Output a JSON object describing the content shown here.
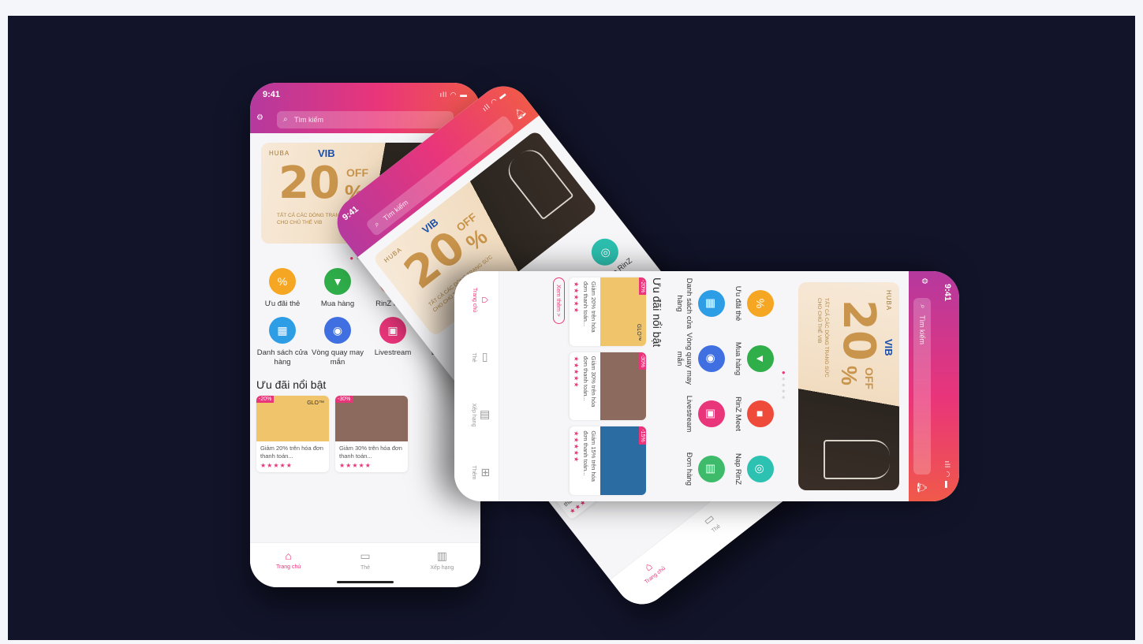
{
  "status": {
    "time": "9:41",
    "icons": "ıll ◠ ▬"
  },
  "search": {
    "placeholder": "Tìm kiếm"
  },
  "banner": {
    "brand": "HUBA",
    "partner": "VIB",
    "discount_number": "20",
    "discount_off": "OFF",
    "discount_pct": "%",
    "subtitle_line1": "TẤT CẢ CÁC DÒNG TRANG SỨC",
    "subtitle_line2": "CHO CHỦ THẺ VIB"
  },
  "pager": {
    "active": "●",
    "rest": "●●●●"
  },
  "grid_items": [
    {
      "label": "Ưu đãi thẻ",
      "icon": "percent-icon",
      "color": "#f5a623",
      "glyph": "%"
    },
    {
      "label": "Mua hàng",
      "icon": "cart-icon",
      "color": "#2fae4a",
      "glyph": "▼"
    },
    {
      "label": "RinZ Meet",
      "icon": "video-icon",
      "color": "#ee4b3a",
      "glyph": "■"
    },
    {
      "label": "Danh sách cửa hàng",
      "icon": "store-icon",
      "color": "#2d9de6",
      "glyph": "▦"
    },
    {
      "label": "Vòng quay may mắn",
      "icon": "wheel-icon",
      "color": "#3f6fe0",
      "glyph": "◉"
    },
    {
      "label": "Livestream",
      "icon": "live-icon",
      "color": "#e9357a",
      "glyph": "▣"
    },
    {
      "label": "Nạp RinZ",
      "icon": "topup-icon",
      "color": "#2cc1b0",
      "glyph": "◎"
    },
    {
      "label": "Đơn hàng",
      "icon": "order-icon",
      "color": "#3dbb6a",
      "glyph": "▤"
    }
  ],
  "featured": {
    "title": "Ưu đãi nổi bật",
    "see_more": "Xem thêm >"
  },
  "cards": [
    {
      "discount": "-20%",
      "logo": "GLO™",
      "desc": "Giảm 20% trên hóa đơn thanh toán...",
      "stars": "★★★★★",
      "bg": "#f0c46a"
    },
    {
      "discount": "-30%",
      "logo": "",
      "desc": "Giảm 30% trên hóa đơn thanh toán...",
      "stars": "★★★★★",
      "bg": "#8c6a5e"
    },
    {
      "discount": "-15%",
      "logo": "",
      "desc": "Giảm 15% trên hóa đơn thanh toán...",
      "stars": "★★★★★",
      "bg": "#2b6ca3"
    }
  ],
  "tabs": [
    {
      "label": "Trang chủ",
      "icon": "home-icon",
      "glyph": "⌂"
    },
    {
      "label": "Thẻ",
      "icon": "card-icon",
      "glyph": "▭"
    },
    {
      "label": "Xếp hạng",
      "icon": "ranking-icon",
      "glyph": "▥"
    },
    {
      "label": "Thêm",
      "icon": "more-icon",
      "glyph": "⊞"
    }
  ]
}
